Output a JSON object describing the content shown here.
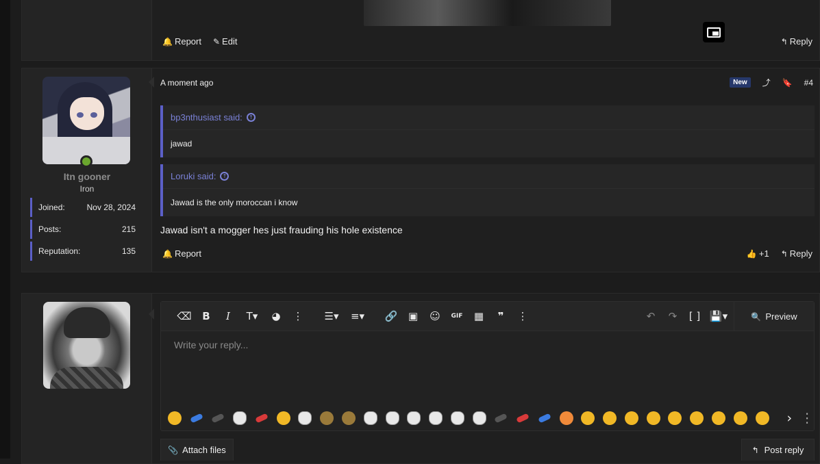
{
  "post1": {
    "report_label": "Report",
    "edit_label": "Edit",
    "reply_label": "Reply"
  },
  "post2": {
    "username": "Itn gooner",
    "rank": "Iron",
    "stats": [
      {
        "label": "Joined:",
        "value": "Nov 28, 2024"
      },
      {
        "label": "Posts:",
        "value": "215"
      },
      {
        "label": "Reputation:",
        "value": "135"
      }
    ],
    "time": "A moment ago",
    "new_badge": "New",
    "post_number": "#4",
    "quotes": [
      {
        "author": "bp3nthusiast said:",
        "text": "jawad"
      },
      {
        "author": "Loruki said:",
        "text": "Jawad is the only moroccan i know"
      }
    ],
    "body": "Jawad isn't a mogger hes just frauding his hole existence",
    "report_label": "Report",
    "like_label": "+1",
    "reply_label": "Reply"
  },
  "editor": {
    "placeholder": "Write your reply...",
    "preview_label": "Preview",
    "attach_label": "Attach files",
    "post_reply_label": "Post reply"
  },
  "colors": {
    "accent": "#5b5fc7",
    "quote_author": "#7a81d6",
    "online": "#6aa62e",
    "new_badge_bg": "#26386b"
  },
  "icons": [
    "bell-icon",
    "pencil-icon",
    "reply-icon",
    "share-icon",
    "bookmark-icon",
    "quote-arrow-icon",
    "thumbs-up-icon",
    "eraser-icon",
    "bold-icon",
    "italic-icon",
    "text-size-icon",
    "palette-icon",
    "more-icon",
    "list-icon",
    "align-icon",
    "link-icon",
    "image-icon",
    "smiley-icon",
    "gif-icon",
    "media-icon",
    "quote-icon",
    "undo-icon",
    "redo-icon",
    "bbcode-icon",
    "save-icon",
    "preview-icon",
    "paperclip-icon",
    "chevron-right-icon",
    "picture-in-picture-icon"
  ]
}
